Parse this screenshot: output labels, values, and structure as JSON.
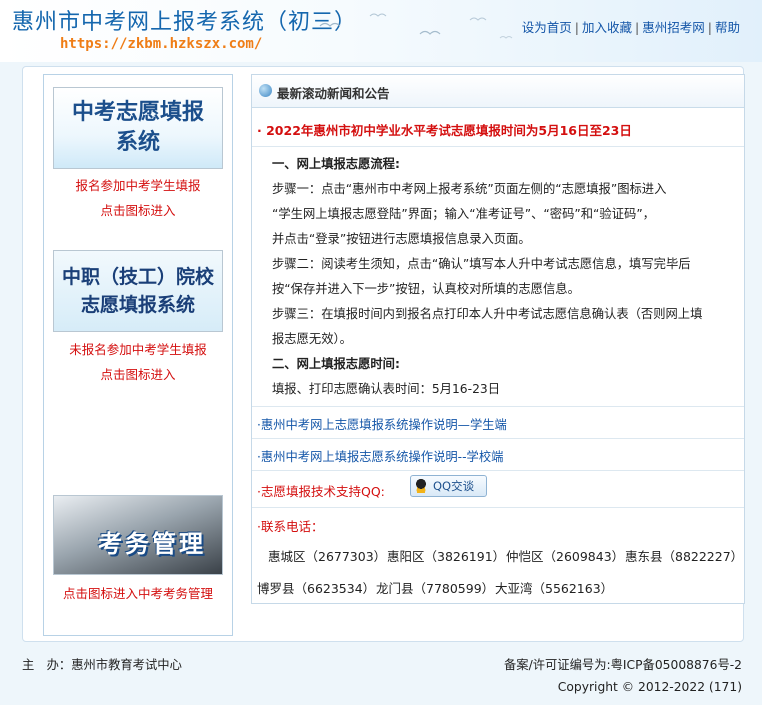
{
  "header": {
    "title": "惠州市中考网上报考系统（初三）",
    "url": "https://zkbm.hzkszx.com/",
    "links": [
      "设为首页",
      "加入收藏",
      "惠州招考网",
      "帮助"
    ]
  },
  "left": {
    "blocks": [
      {
        "banner_lines": [
          "中考志愿填报",
          "系统"
        ],
        "captions": [
          "报名参加中考学生填报",
          "点击图标进入"
        ]
      },
      {
        "banner_lines": [
          "中职（技工）院校",
          "志愿填报系统"
        ],
        "captions": [
          "未报名参加中考学生填报",
          "点击图标进入"
        ]
      },
      {
        "banner_lines": [
          "考务管理"
        ],
        "captions": [
          "点击图标进入中考考务管理"
        ]
      }
    ]
  },
  "panel": {
    "title": "最新滚动新闻和公告",
    "headline": "· 2022年惠州市初中学业水平考试志愿填报时间为5月16日至23日",
    "process_lines": [
      "一、网上填报志愿流程:",
      "步骤一：点击“惠州市中考网上报考系统”页面左侧的“志愿填报”图标进入",
      "“学生网上填报志愿登陆”界面；输入“准考证号”、“密码”和“验证码”，",
      "并点击“登录”按钮进行志愿填报信息录入页面。",
      "步骤二：阅读考生须知，点击“确认”填写本人升中考试志愿信息，填写完毕后",
      "按“保存并进入下一步”按钮，认真校对所填的志愿信息。",
      "步骤三：在填报时间内到报名点打印本人升中考试志愿信息确认表（否则网上填",
      "报志愿无效）。",
      "二、网上填报志愿时间:",
      "填报、打印志愿确认表时间：5月16-23日"
    ],
    "link1": "·惠州中考网上志愿填报系统操作说明—学生端",
    "link2": "·惠州中考网上填报志愿系统操作说明--学校端",
    "qq_label": "·志愿填报技术支持QQ:",
    "qq_button": "QQ交谈",
    "contact_label": "·联系电话：",
    "phones_row1": [
      "惠城区（2677303）",
      "惠阳区（3826191）",
      "仲恺区（2609843）",
      "惠东县（8822227）"
    ],
    "phones_row2": [
      "博罗县（6623534）",
      "龙门县（7780599）",
      "大亚湾（5562163）"
    ]
  },
  "footer": {
    "sponsor": "主　办：惠州市教育考试中心",
    "icp": "备案/许可证编号为:粤ICP备05008876号-2",
    "copyright": "Copyright © 2012-2022 (171)"
  },
  "colors": {
    "title_blue": "#1567ae",
    "url_orange": "#ef7d16",
    "alert_red": "#d40f0f",
    "link_blue": "#1456a8"
  }
}
